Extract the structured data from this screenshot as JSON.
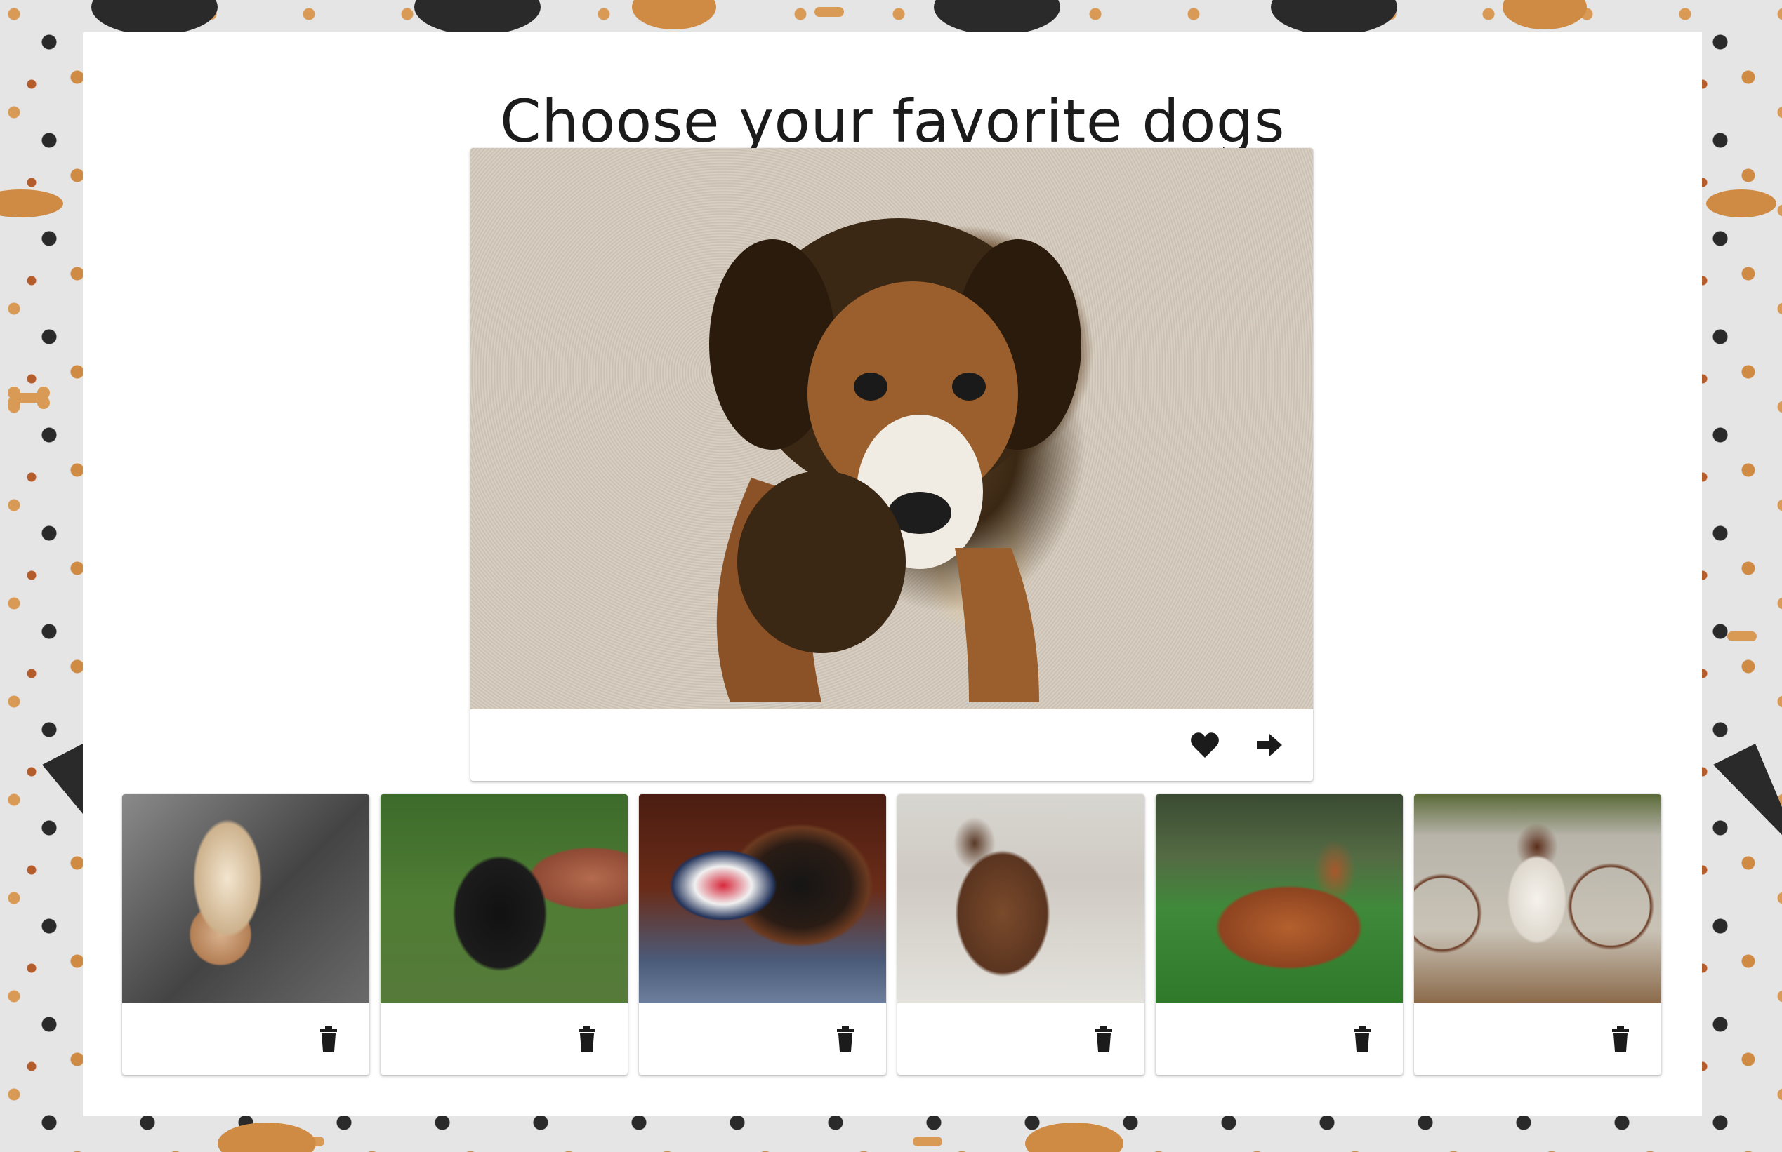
{
  "page": {
    "title": "Choose your favorite dogs"
  },
  "featured": {
    "image_description_icon": "dog-photo",
    "actions": [
      {
        "name": "like",
        "icon": "heart-icon"
      },
      {
        "name": "next",
        "icon": "arrow-right-icon"
      }
    ]
  },
  "favorites": [
    {
      "icon": "dog-photo",
      "action_icon": "trash-icon"
    },
    {
      "icon": "dog-photo",
      "action_icon": "trash-icon"
    },
    {
      "icon": "dog-photo",
      "action_icon": "trash-icon"
    },
    {
      "icon": "dog-photo",
      "action_icon": "trash-icon"
    },
    {
      "icon": "dog-photo",
      "action_icon": "trash-icon"
    },
    {
      "icon": "dog-photo",
      "action_icon": "trash-icon"
    }
  ],
  "colors": {
    "text": "#1b1b1b",
    "panel": "#ffffff",
    "background": "#e5e5e5",
    "accent_brown": "#cf8b44",
    "accent_dark": "#2a2a2a"
  }
}
